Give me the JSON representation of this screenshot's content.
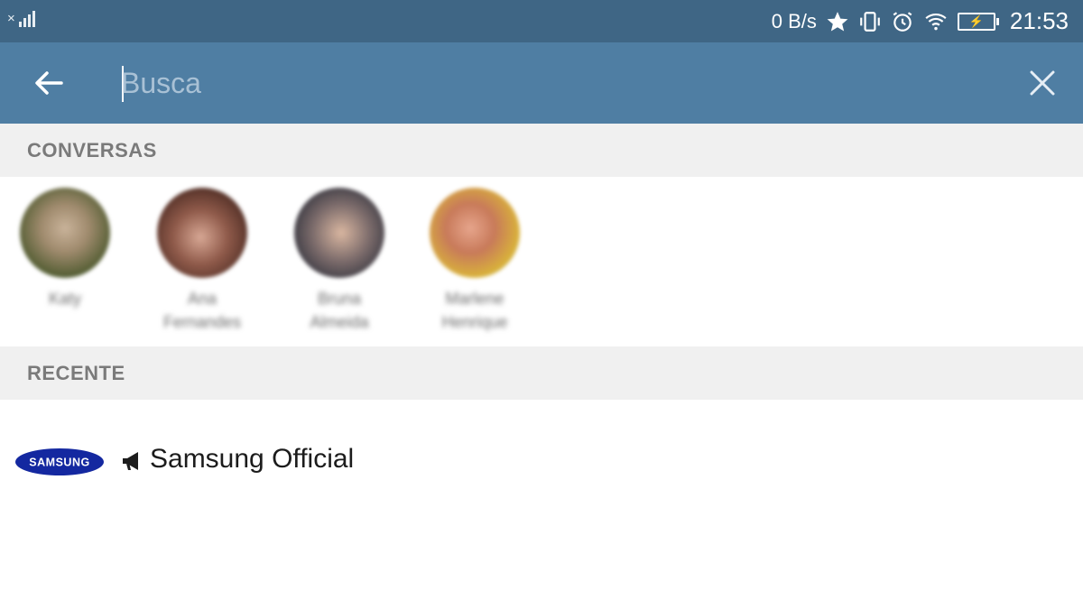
{
  "status_bar": {
    "network_speed": "0 B/s",
    "time": "21:53",
    "icons": [
      "no-sim-signal-icon",
      "star-icon",
      "vibrate-icon",
      "alarm-icon",
      "wifi-icon",
      "battery-charging-icon"
    ]
  },
  "app_bar": {
    "back_icon": "arrow-left-icon",
    "search": {
      "placeholder": "Busca",
      "value": ""
    },
    "clear_icon": "close-icon",
    "color": "#4f7ea3"
  },
  "sections": {
    "conversations_title": "CONVERSAS",
    "recent_title": "RECENTE"
  },
  "conversations": [
    {
      "name_line1": "Katy",
      "name_line2": "",
      "avatar_colors": [
        "#c9b39a",
        "#4e5a2f"
      ]
    },
    {
      "name_line1": "Ana",
      "name_line2": "Fernandes",
      "avatar_colors": [
        "#d7a794",
        "#4a2a22"
      ]
    },
    {
      "name_line1": "Bruna",
      "name_line2": "Almeida",
      "avatar_colors": [
        "#d9b6a0",
        "#2c2f3a"
      ]
    },
    {
      "name_line1": "Marlene",
      "name_line2": "Henrique",
      "avatar_colors": [
        "#e6a58c",
        "#d9b23a"
      ]
    }
  ],
  "recent": [
    {
      "title": "Samsung Official",
      "type_icon": "megaphone-icon",
      "logo_text": "SAMSUNG",
      "logo_color": "#1428a0"
    }
  ]
}
